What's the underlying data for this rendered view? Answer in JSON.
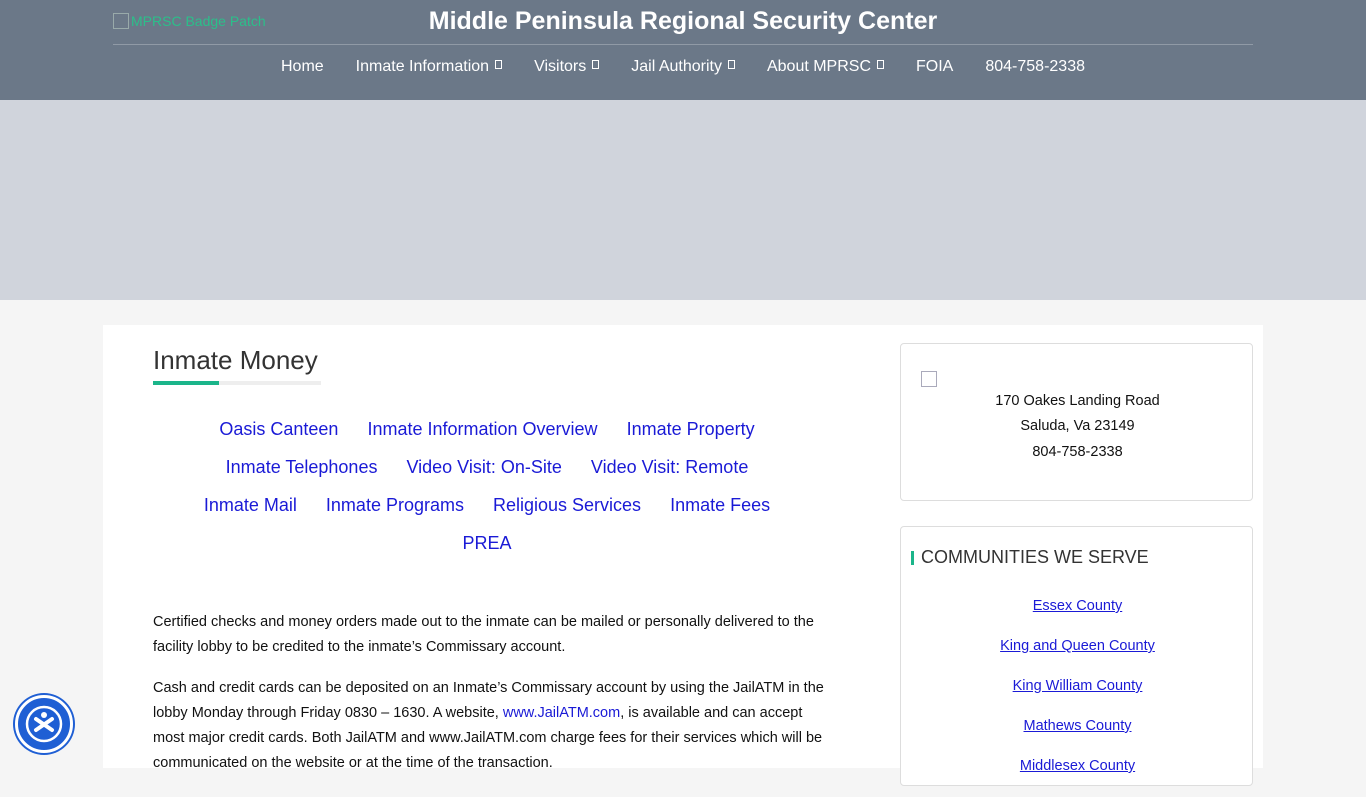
{
  "header": {
    "logo_alt": "MPRSC Badge Patch",
    "title": "Middle Peninsula Regional Security Center"
  },
  "nav": {
    "items": [
      {
        "label": "Home"
      },
      {
        "label": "Inmate Information"
      },
      {
        "label": "Visitors"
      },
      {
        "label": "Jail Authority"
      },
      {
        "label": "About MPRSC"
      },
      {
        "label": "FOIA"
      },
      {
        "label": "804-758-2338"
      }
    ]
  },
  "main": {
    "title": "Inmate Money",
    "subnav": [
      "Oasis Canteen",
      "Inmate Information Overview",
      "Inmate Property",
      "Inmate Telephones",
      "Video Visit: On-Site",
      "Video Visit: Remote",
      "Inmate Mail",
      "Inmate Programs",
      "Religious Services",
      "Inmate Fees",
      "PREA"
    ],
    "para1": "Certified checks and money orders made out to the inmate can be mailed or personally delivered to the facility lobby to be credited to the inmate’s Commissary account.",
    "para2_a": "Cash and credit cards can be deposited on an Inmate’s Commissary account by using the JailATM in the lobby Monday through Friday 0830 – 1630.  A website, ",
    "para2_link": "www.JailATM.com",
    "para2_b": ", is available and can accept most major credit cards.  Both JailATM and www.JailATM.com charge fees for their services which will be communicated on the website or at the time of the transaction."
  },
  "sidebar": {
    "address": {
      "street": "170 Oakes Landing Road",
      "city": "Saluda, Va 23149",
      "phone": "804-758-2338"
    },
    "communities": {
      "title": "COMMUNITIES WE SERVE",
      "items": [
        "Essex County",
        "King and Queen County",
        "King William County",
        "Mathews County",
        "Middlesex County"
      ]
    }
  },
  "colors": {
    "header_bg": "#6b7888",
    "accent": "#1bb58a",
    "link": "#1a1ad6",
    "banner_bg": "#d0d4dc"
  },
  "icons": {
    "accessibility": "accessibility-icon"
  }
}
